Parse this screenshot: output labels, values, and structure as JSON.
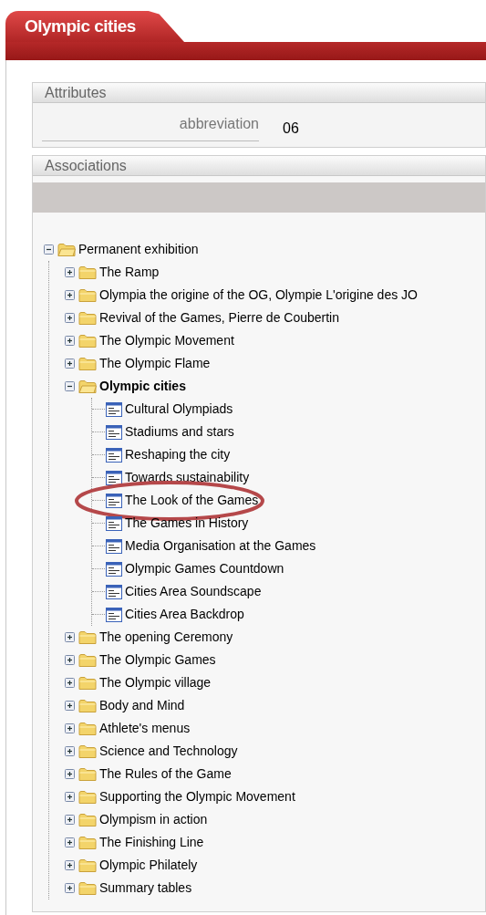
{
  "tab": {
    "title": "Olympic cities"
  },
  "attributes": {
    "title": "Attributes",
    "fields": [
      {
        "label": "abbreviation",
        "value": "06"
      }
    ]
  },
  "associations": {
    "title": "Associations",
    "tree": [
      {
        "label": "Permanent exhibition",
        "kind": "folder",
        "expanded": true,
        "selected": false,
        "children": [
          {
            "label": "The Ramp",
            "kind": "folder",
            "expanded": false,
            "selected": false
          },
          {
            "label": "Olympia the origine of the OG, Olympie L'origine des JO",
            "kind": "folder",
            "expanded": false,
            "selected": false
          },
          {
            "label": "Revival of the Games, Pierre de Coubertin",
            "kind": "folder",
            "expanded": false,
            "selected": false
          },
          {
            "label": "The Olympic Movement",
            "kind": "folder",
            "expanded": false,
            "selected": false
          },
          {
            "label": "The Olympic Flame",
            "kind": "folder",
            "expanded": false,
            "selected": false
          },
          {
            "label": "Olympic cities",
            "kind": "folder",
            "expanded": true,
            "selected": true,
            "children": [
              {
                "label": "Cultural Olympiads",
                "kind": "document",
                "circled": false
              },
              {
                "label": "Stadiums and stars",
                "kind": "document",
                "circled": false
              },
              {
                "label": "Reshaping the city",
                "kind": "document",
                "circled": false
              },
              {
                "label": "Towards sustainability",
                "kind": "document",
                "circled": false
              },
              {
                "label": "The Look of the Games",
                "kind": "document",
                "circled": true
              },
              {
                "label": "The Games in History",
                "kind": "document",
                "circled": false
              },
              {
                "label": "Media Organisation at the Games",
                "kind": "document",
                "circled": false
              },
              {
                "label": "Olympic Games Countdown",
                "kind": "document",
                "circled": false
              },
              {
                "label": "Cities Area Soundscape",
                "kind": "document",
                "circled": false
              },
              {
                "label": "Cities Area Backdrop",
                "kind": "document",
                "circled": false
              }
            ]
          },
          {
            "label": "The opening Ceremony",
            "kind": "folder",
            "expanded": false,
            "selected": false
          },
          {
            "label": "The Olympic Games",
            "kind": "folder",
            "expanded": false,
            "selected": false
          },
          {
            "label": "The Olympic village",
            "kind": "folder",
            "expanded": false,
            "selected": false
          },
          {
            "label": "Body and Mind",
            "kind": "folder",
            "expanded": false,
            "selected": false
          },
          {
            "label": "Athlete's menus",
            "kind": "folder",
            "expanded": false,
            "selected": false
          },
          {
            "label": "Science and Technology",
            "kind": "folder",
            "expanded": false,
            "selected": false
          },
          {
            "label": "The Rules of the Game",
            "kind": "folder",
            "expanded": false,
            "selected": false
          },
          {
            "label": "Supporting the Olympic Movement",
            "kind": "folder",
            "expanded": false,
            "selected": false
          },
          {
            "label": "Olympism in action",
            "kind": "folder",
            "expanded": false,
            "selected": false
          },
          {
            "label": "The Finishing Line",
            "kind": "folder",
            "expanded": false,
            "selected": false
          },
          {
            "label": "Olympic Philately",
            "kind": "folder",
            "expanded": false,
            "selected": false
          },
          {
            "label": "Summary tables",
            "kind": "folder",
            "expanded": false,
            "selected": false
          }
        ]
      }
    ]
  }
}
